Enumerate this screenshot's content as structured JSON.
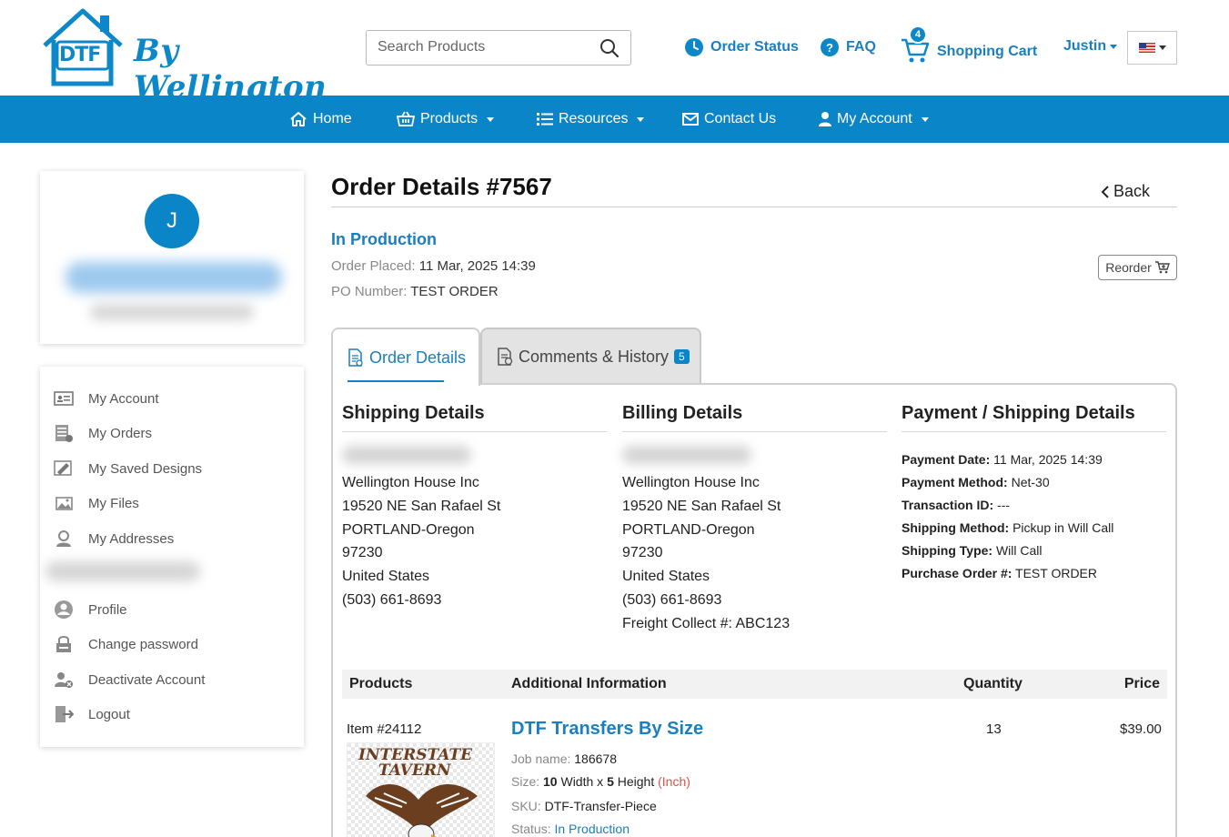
{
  "header": {
    "logo_text": "DTF",
    "logo_script": "By Wellington",
    "search_placeholder": "Search Products",
    "order_status": "Order Status",
    "faq": "FAQ",
    "cart_count": "4",
    "shopping_cart": "Shopping Cart",
    "user": "Justin"
  },
  "nav": {
    "home": "Home",
    "products": "Products",
    "resources": "Resources",
    "contact": "Contact Us",
    "account": "My Account"
  },
  "profile": {
    "initial": "J"
  },
  "sidebar": {
    "items": [
      "My Account",
      "My Orders",
      "My Saved Designs",
      "My Files",
      "My Addresses",
      "Profile",
      "Change password",
      "Deactivate Account",
      "Logout"
    ]
  },
  "order": {
    "title": "Order Details #7567",
    "back": "Back",
    "status": "In Production",
    "placed_label": "Order Placed:",
    "placed_value": "11 Mar, 2025 14:39",
    "po_label": "PO Number:",
    "po_value": "TEST ORDER",
    "reorder": "Reorder"
  },
  "tabs": {
    "details": "Order Details",
    "comments": "Comments & History",
    "comments_count": "5"
  },
  "shipping": {
    "heading": "Shipping Details",
    "lines": [
      "Wellington House Inc",
      "19520 NE San Rafael St",
      "PORTLAND-Oregon",
      "97230",
      "United States",
      "(503) 661-8693"
    ]
  },
  "billing": {
    "heading": "Billing Details",
    "lines": [
      "Wellington House Inc",
      "19520 NE San Rafael St",
      "PORTLAND-Oregon",
      "97230",
      "United States",
      "(503) 661-8693",
      "Freight Collect #: ABC123"
    ]
  },
  "payment": {
    "heading": "Payment / Shipping Details",
    "rows": [
      {
        "label": "Payment Date:",
        "value": "11 Mar, 2025 14:39"
      },
      {
        "label": "Payment Method:",
        "value": "Net-30"
      },
      {
        "label": "Transaction ID:",
        "value": "---"
      },
      {
        "label": "Shipping Method:",
        "value": "Pickup in Will Call"
      },
      {
        "label": "Shipping Type:",
        "value": "Will Call"
      },
      {
        "label": "Purchase Order #:",
        "value": "TEST ORDER"
      }
    ]
  },
  "table": {
    "headers": [
      "Products",
      "Additional Information",
      "Quantity",
      "Price"
    ],
    "item": {
      "number": "Item #24112",
      "image_text_1": "INTERSTATE",
      "image_text_2": "TAVERN",
      "name": "DTF Transfers By Size",
      "job_label": "Job name:",
      "job_value": "186678",
      "size_label": "Size:",
      "size_w": "10",
      "size_w_label": "Width x",
      "size_h": "5",
      "size_h_label": "Height",
      "size_unit": "(Inch)",
      "sku_label": "SKU:",
      "sku_value": "DTF-Transfer-Piece",
      "status_label": "Status:",
      "status_value": "In Production",
      "quantity": "13",
      "price": "$39.00"
    }
  }
}
